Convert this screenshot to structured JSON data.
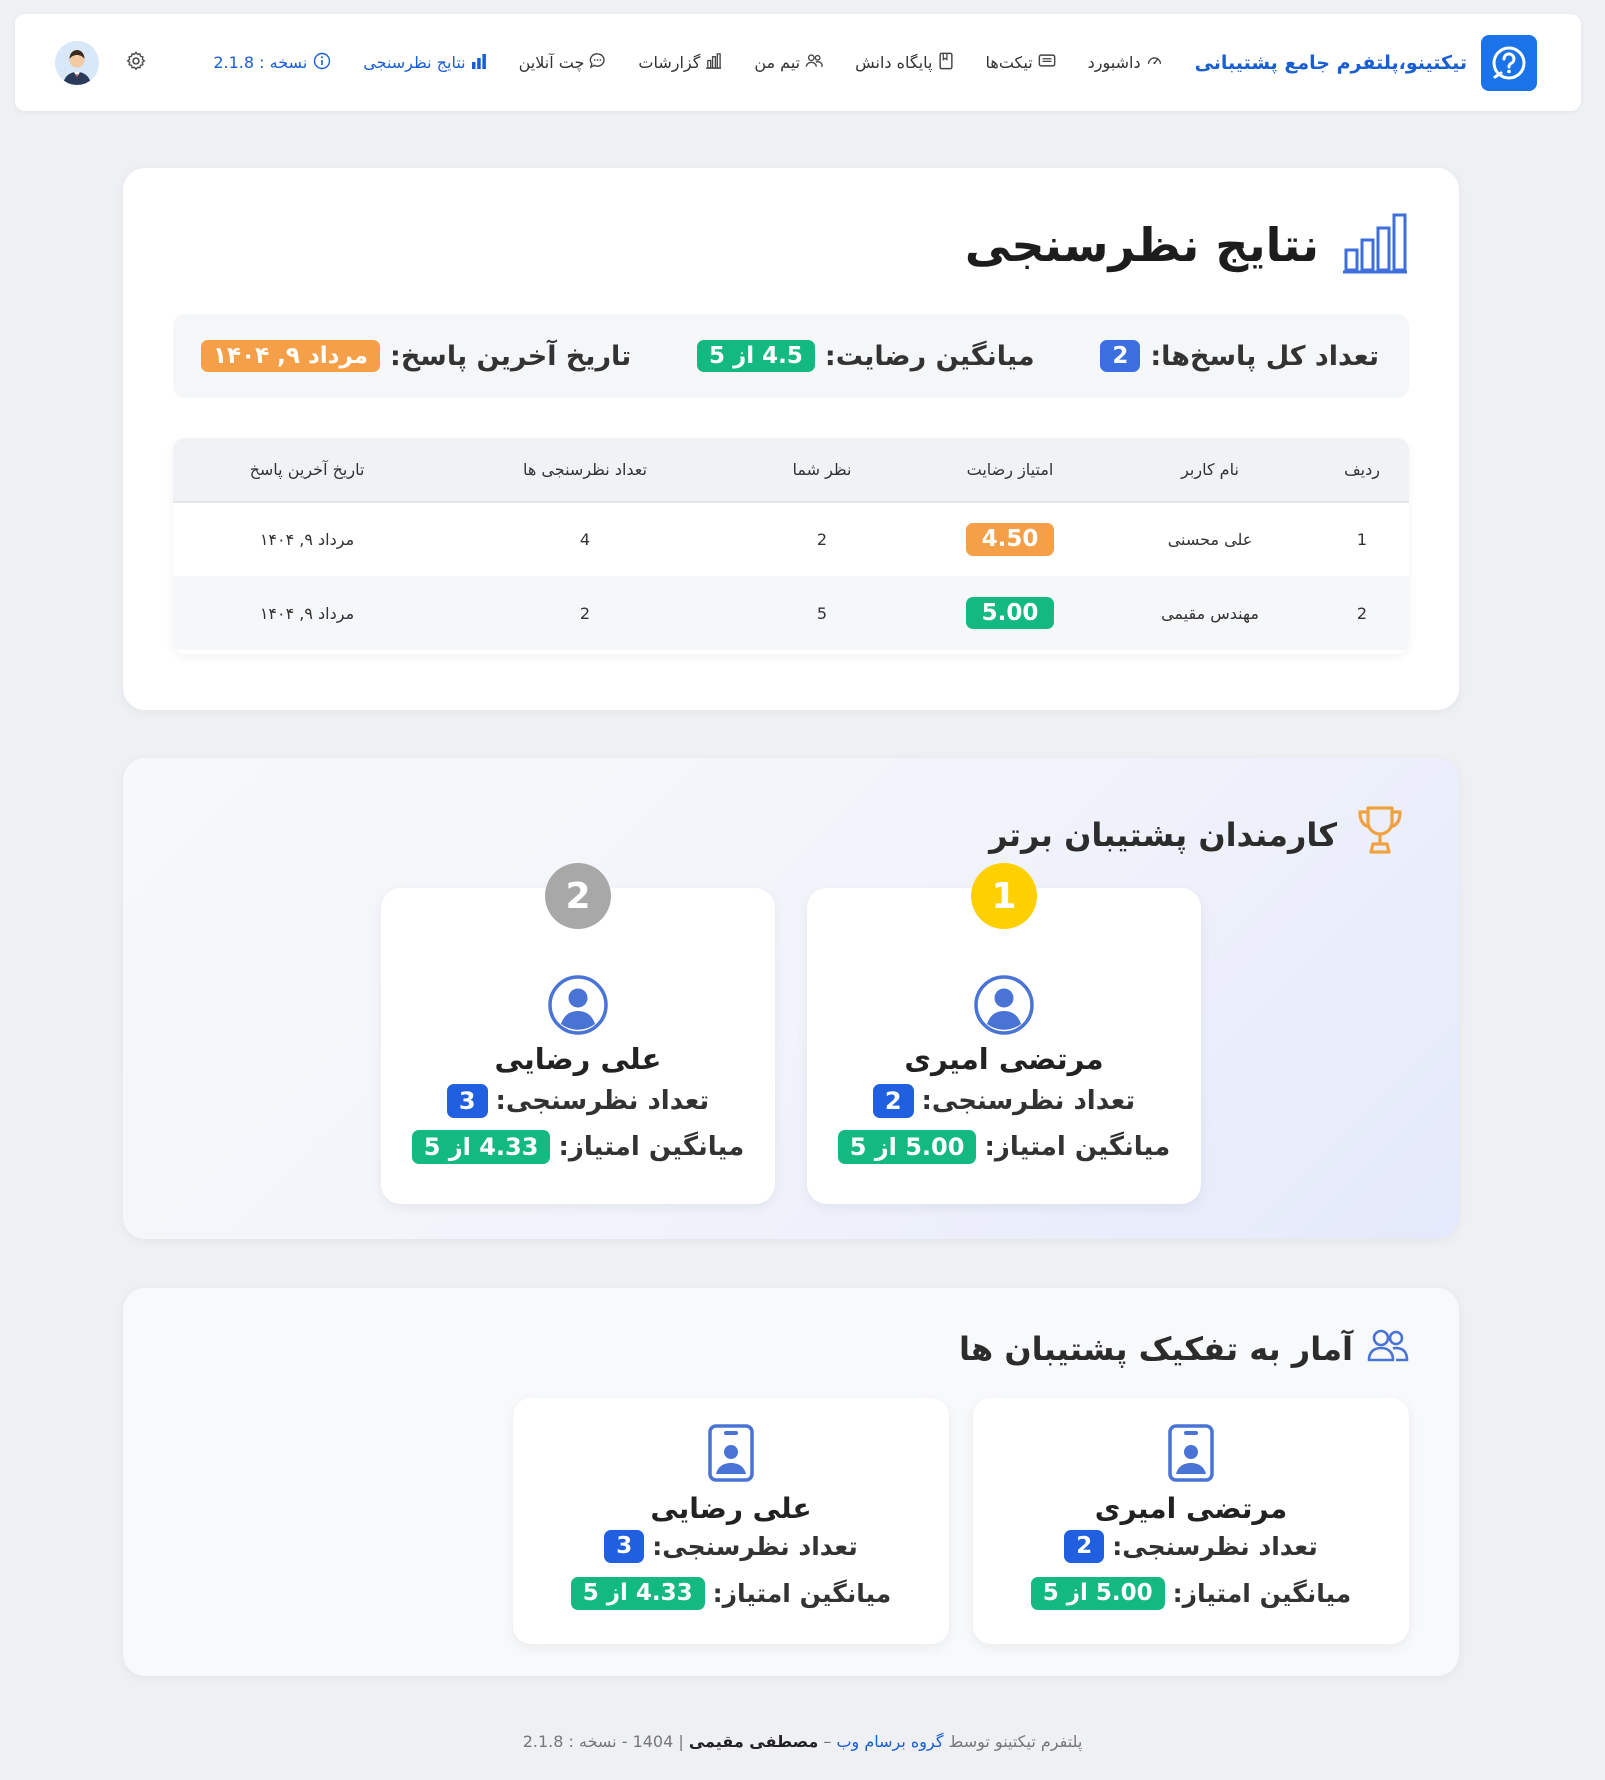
{
  "nav": {
    "brand": "تیکتینو،پلتفرم جامع پشتیبانی",
    "items": [
      {
        "label": "داشبورد",
        "icon": "gauge-icon"
      },
      {
        "label": "تیکت‌ها",
        "icon": "ticket-icon"
      },
      {
        "label": "پایگاه دانش",
        "icon": "book-icon"
      },
      {
        "label": "تیم من",
        "icon": "team-icon"
      },
      {
        "label": "گزارشات",
        "icon": "bar-chart-icon"
      },
      {
        "label": "چت آنلاین",
        "icon": "chat-icon"
      },
      {
        "label": "نتایج نظرسنجی",
        "icon": "chart-filled-icon"
      }
    ],
    "version": "نسخه : 2.1.8"
  },
  "results": {
    "title": "نتایج نظرسنجی",
    "total_label": "تعداد کل پاسخ‌ها:",
    "total_value": "2",
    "avg_label": "میانگین رضایت:",
    "avg_value": "4.5 از 5",
    "last_label": "تاریخ آخرین پاسخ:",
    "last_value": "مرداد ۹, ۱۴۰۴",
    "table": {
      "headers": [
        "ردیف",
        "نام کاربر",
        "امتیاز رضایت",
        "نظر شما",
        "تعداد نظرسنجی ها",
        "تاریخ آخرین پاسخ"
      ],
      "rows": [
        {
          "index": "1",
          "user": "علی محسنی",
          "score": "4.50",
          "opinion": "2",
          "count": "4",
          "date": "مرداد ۹, ۱۴۰۴"
        },
        {
          "index": "2",
          "user": "مهندس مقیمی",
          "score": "5.00",
          "opinion": "5",
          "count": "2",
          "date": "مرداد ۹, ۱۴۰۴"
        }
      ]
    }
  },
  "top": {
    "title": "کارمندان پشتیبان برتر",
    "count_label": "تعداد نظرسنجی:",
    "avg_label": "میانگین امتیاز:",
    "cards": [
      {
        "rank": "1",
        "name": "مرتضی امیری",
        "count": "2",
        "avg": "5.00 از 5"
      },
      {
        "rank": "2",
        "name": "علی رضایی",
        "count": "3",
        "avg": "4.33 از 5"
      }
    ]
  },
  "breakdown": {
    "title": "آمار به تفکیک پشتیبان ها",
    "count_label": "تعداد نظرسنجی:",
    "avg_label": "میانگین امتیاز:",
    "cards": [
      {
        "name": "مرتضی امیری",
        "count": "2",
        "avg": "5.00 از 5"
      },
      {
        "name": "علی رضایی",
        "count": "3",
        "avg": "4.33 از 5"
      }
    ]
  },
  "footer": {
    "prefix": "پلتفرم تیکتینو توسط",
    "company": "گروه برسام وب",
    "dash": "–",
    "author": "مصطفی مقیمی",
    "suffix": "| 1404 - نسخه : 2.1.8"
  },
  "colors": {
    "primary": "#1a5fd1",
    "badge_blue": "#3b6fe0",
    "badge_green": "#14b981",
    "badge_orange": "#f5a048",
    "rank_gold": "#ffd000",
    "rank_silver": "#a8a8a8"
  }
}
